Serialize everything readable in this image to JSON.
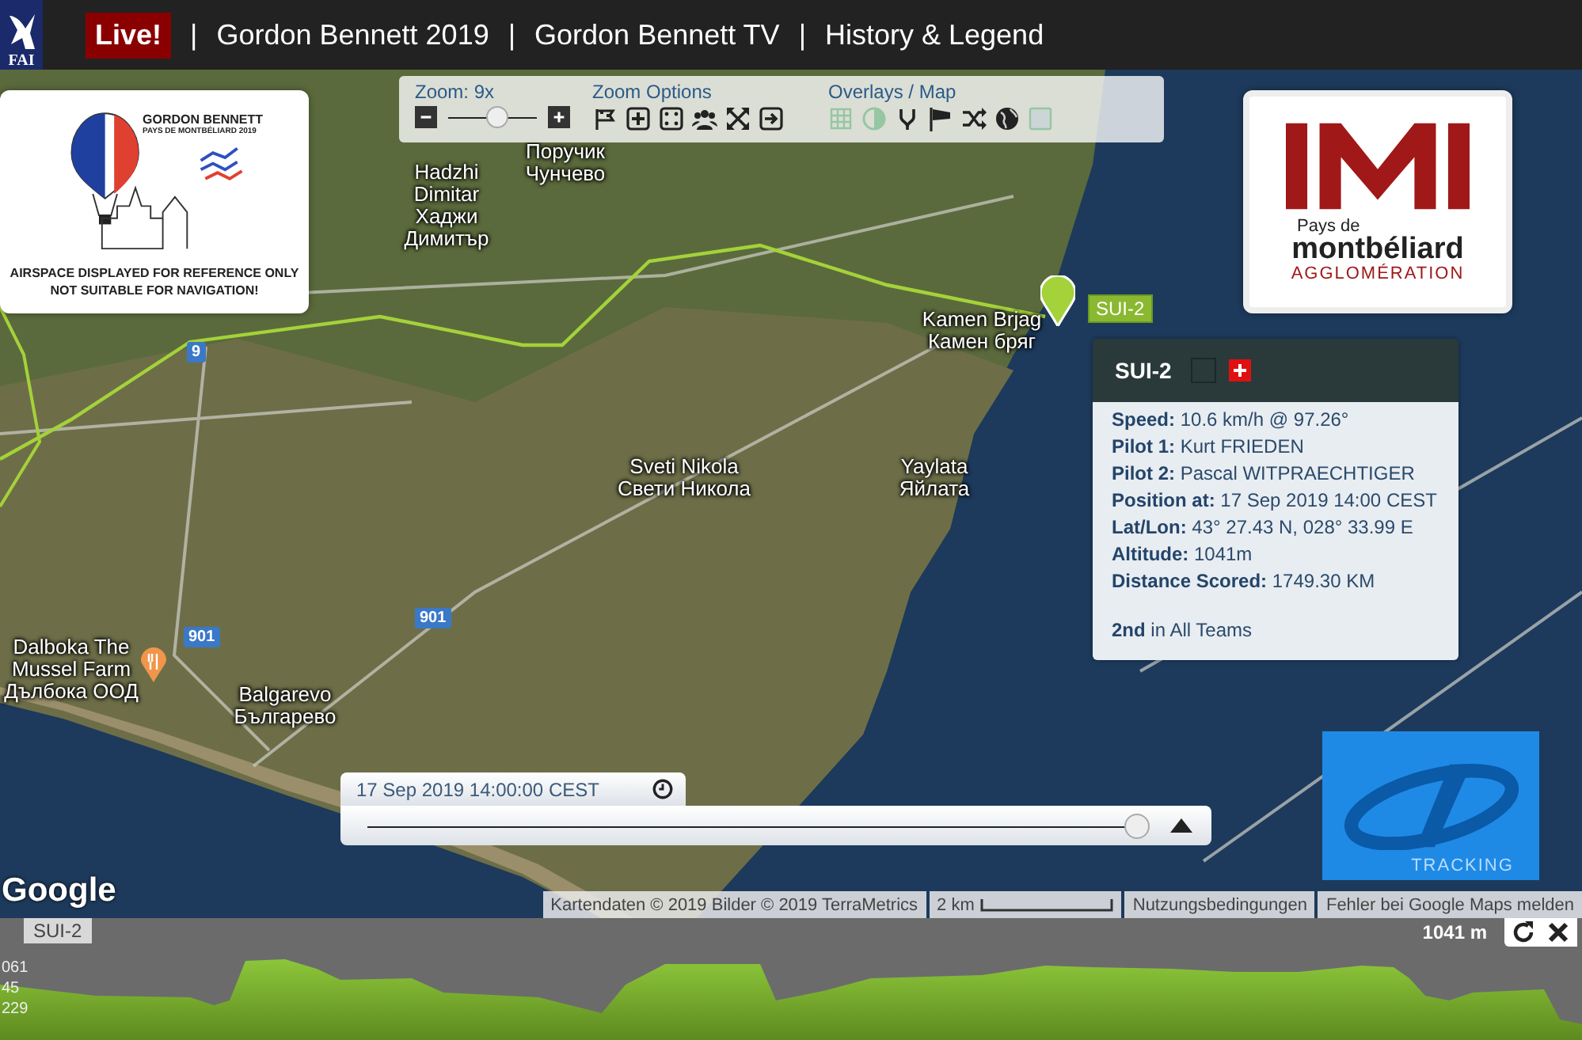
{
  "header": {
    "logo_text": "FAI",
    "live": "Live!",
    "separator": "|",
    "links": [
      {
        "label": "Gordon Bennett 2019"
      },
      {
        "label": "Gordon Bennett TV"
      },
      {
        "label": "History & Legend"
      }
    ]
  },
  "toolbar": {
    "zoom": {
      "label": "Zoom: 9x",
      "level": 0.55
    },
    "zoom_options": {
      "title": "Zoom Options",
      "tools": [
        {
          "kind": "flag"
        },
        {
          "kind": "plus"
        },
        {
          "kind": "dice"
        },
        {
          "kind": "people"
        },
        {
          "kind": "expand"
        },
        {
          "kind": "exit"
        }
      ]
    },
    "overlays": {
      "title": "Overlays / Map",
      "items": [
        {
          "kind": "grid",
          "on": false
        },
        {
          "kind": "contrast",
          "on": false
        },
        {
          "kind": "fork",
          "on": true
        },
        {
          "kind": "windsock",
          "on": true
        },
        {
          "kind": "shuffle",
          "on": true
        },
        {
          "kind": "globe",
          "on": true
        },
        {
          "kind": "square",
          "on": false
        }
      ]
    }
  },
  "airspace_card": {
    "logo_lines": [
      "GORDON BENNETT",
      "PAYS DE MONTBÉLIARD 2019"
    ],
    "notice": [
      "AIRSPACE DISPLAYED FOR REFERENCE ONLY",
      "NOT SUITABLE FOR NAVIGATION!"
    ]
  },
  "sponsor_card": {
    "lines": [
      "Pays de",
      "montbéliard",
      "AGGLOMÉRATION"
    ]
  },
  "map": {
    "labels": [
      {
        "lines": [
          "Поручик",
          "Чунчево"
        ]
      },
      {
        "lines": [
          "Hadzhi",
          "Dimitar",
          "Хаджи",
          "Димитър"
        ]
      },
      {
        "lines": [
          "Kamen Brjag",
          "Камен бряг"
        ]
      },
      {
        "lines": [
          "Sveti Nikola",
          "Свети Никола"
        ]
      },
      {
        "lines": [
          "Yaylata",
          "Яйлата"
        ]
      },
      {
        "lines": [
          "Dalboka The",
          "Mussel Farm",
          "Дълбока ООД"
        ]
      },
      {
        "lines": [
          "Balgarevo",
          "Българево"
        ]
      }
    ],
    "road_shields": [
      "9",
      "901",
      "901"
    ],
    "marker": {
      "label": "SUI-2"
    },
    "google_logo": "Google",
    "attribution": [
      "Kartendaten © 2019 Bilder © 2019 TerraMetrics",
      "2 km",
      "Nutzungsbedingungen",
      "Fehler bei Google Maps melden"
    ]
  },
  "popup": {
    "title": "SUI-2",
    "lines": [
      "**Speed:** 10.6 km/h @ 97.26°",
      "**Pilot 1:** Kurt FRIEDEN",
      "**Pilot 2:** Pascal WITPRAECHTIGER",
      "**Position at:** 17 Sep 2019 14:00 CEST",
      "**Lat/Lon:** 43° 27.43 N, 028° 33.99 E",
      "**Altitude:** 1041m",
      "**Distance Scored:** 1749.30 KM"
    ],
    "rank": "**2nd** in All Teams"
  },
  "time_slider": {
    "time": "17 Sep 2019 14:00:00 CEST",
    "level": 0.99
  },
  "tracking_logo": {
    "text": "TRACKING"
  },
  "elevation": {
    "tab": "SUI-2",
    "readout": "1041 m",
    "ticks": [
      "061",
      "45",
      "229"
    ]
  }
}
